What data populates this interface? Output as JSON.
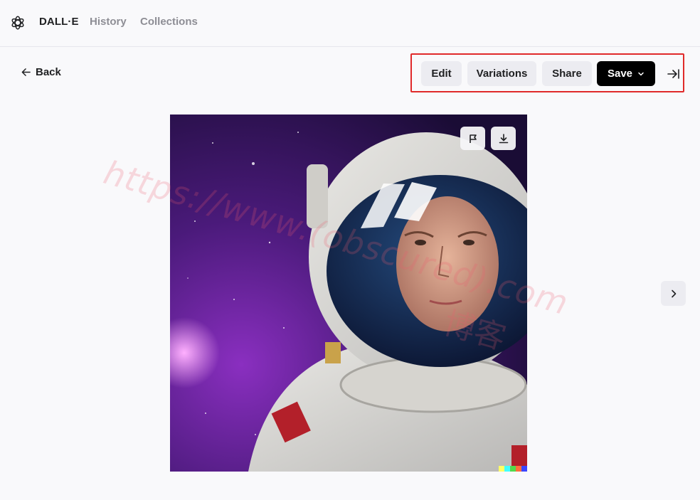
{
  "nav": {
    "brand": "DALL·E",
    "links": [
      "History",
      "Collections"
    ]
  },
  "back": {
    "label": "Back",
    "icon": "arrow-left-icon"
  },
  "toolbar": {
    "edit_label": "Edit",
    "variations_label": "Variations",
    "share_label": "Share",
    "save_label": "Save",
    "save_icon": "chevron-down-icon",
    "collapse_icon": "collapse-panel-icon"
  },
  "image": {
    "overlay_icons": [
      "flag-icon",
      "download-icon"
    ],
    "next_icon": "chevron-right-icon"
  },
  "watermark": {
    "text": "https://www.(obscured).com",
    "cjk": "博客"
  },
  "colors": {
    "background": "#f9f9fb",
    "button_bg": "#ececf1",
    "save_bg": "#000000",
    "highlight_frame": "#e02a2a",
    "nav_muted": "#8e8e95"
  }
}
